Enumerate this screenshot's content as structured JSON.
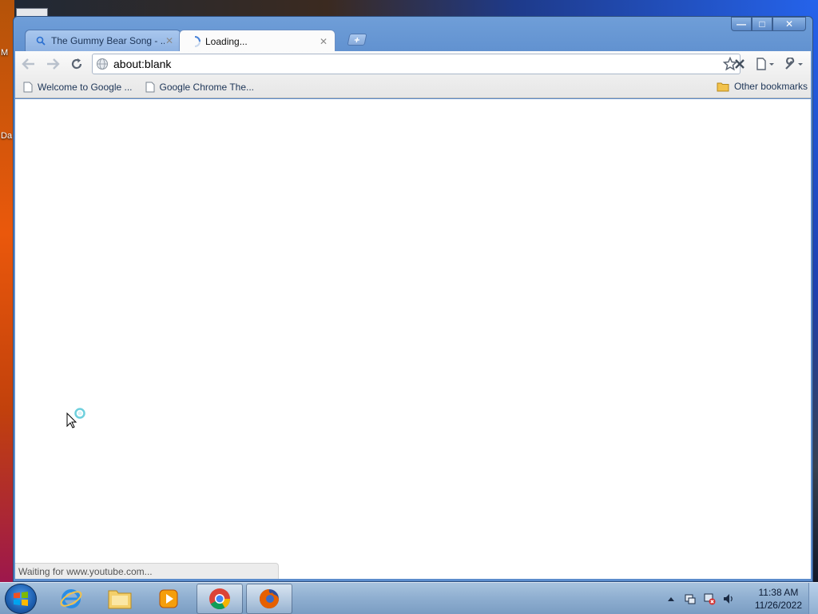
{
  "desktop": {
    "labels": [
      "M",
      "Da"
    ]
  },
  "window": {
    "controls": {
      "minimize": "—",
      "maximize": "□",
      "close": "✕"
    }
  },
  "tabs": [
    {
      "title": "The Gummy Bear Song - ...",
      "icon": "search-icon",
      "state": "inactive"
    },
    {
      "title": "Loading...",
      "icon": "loading-spinner-icon",
      "state": "active"
    }
  ],
  "newtab": {
    "label": "+"
  },
  "toolbar": {
    "url": "about:blank"
  },
  "bookmarks": {
    "items": [
      {
        "label": "Welcome to Google ...",
        "icon": "page-icon"
      },
      {
        "label": "Google Chrome The...",
        "icon": "page-icon"
      }
    ],
    "other": {
      "label": "Other bookmarks",
      "icon": "folder-icon"
    }
  },
  "status": {
    "text": "Waiting for www.youtube.com..."
  },
  "taskbar": {
    "apps": [
      {
        "name": "internet-explorer",
        "open": false
      },
      {
        "name": "file-explorer",
        "open": false
      },
      {
        "name": "media-player",
        "open": false
      },
      {
        "name": "google-chrome",
        "open": true
      },
      {
        "name": "firefox",
        "open": true
      }
    ],
    "clock": {
      "time": "11:38 AM",
      "date": "11/26/2022"
    }
  },
  "colors": {
    "window_frame": "#5c8dcd",
    "link_text": "#1d3557",
    "status_text": "#555555"
  }
}
